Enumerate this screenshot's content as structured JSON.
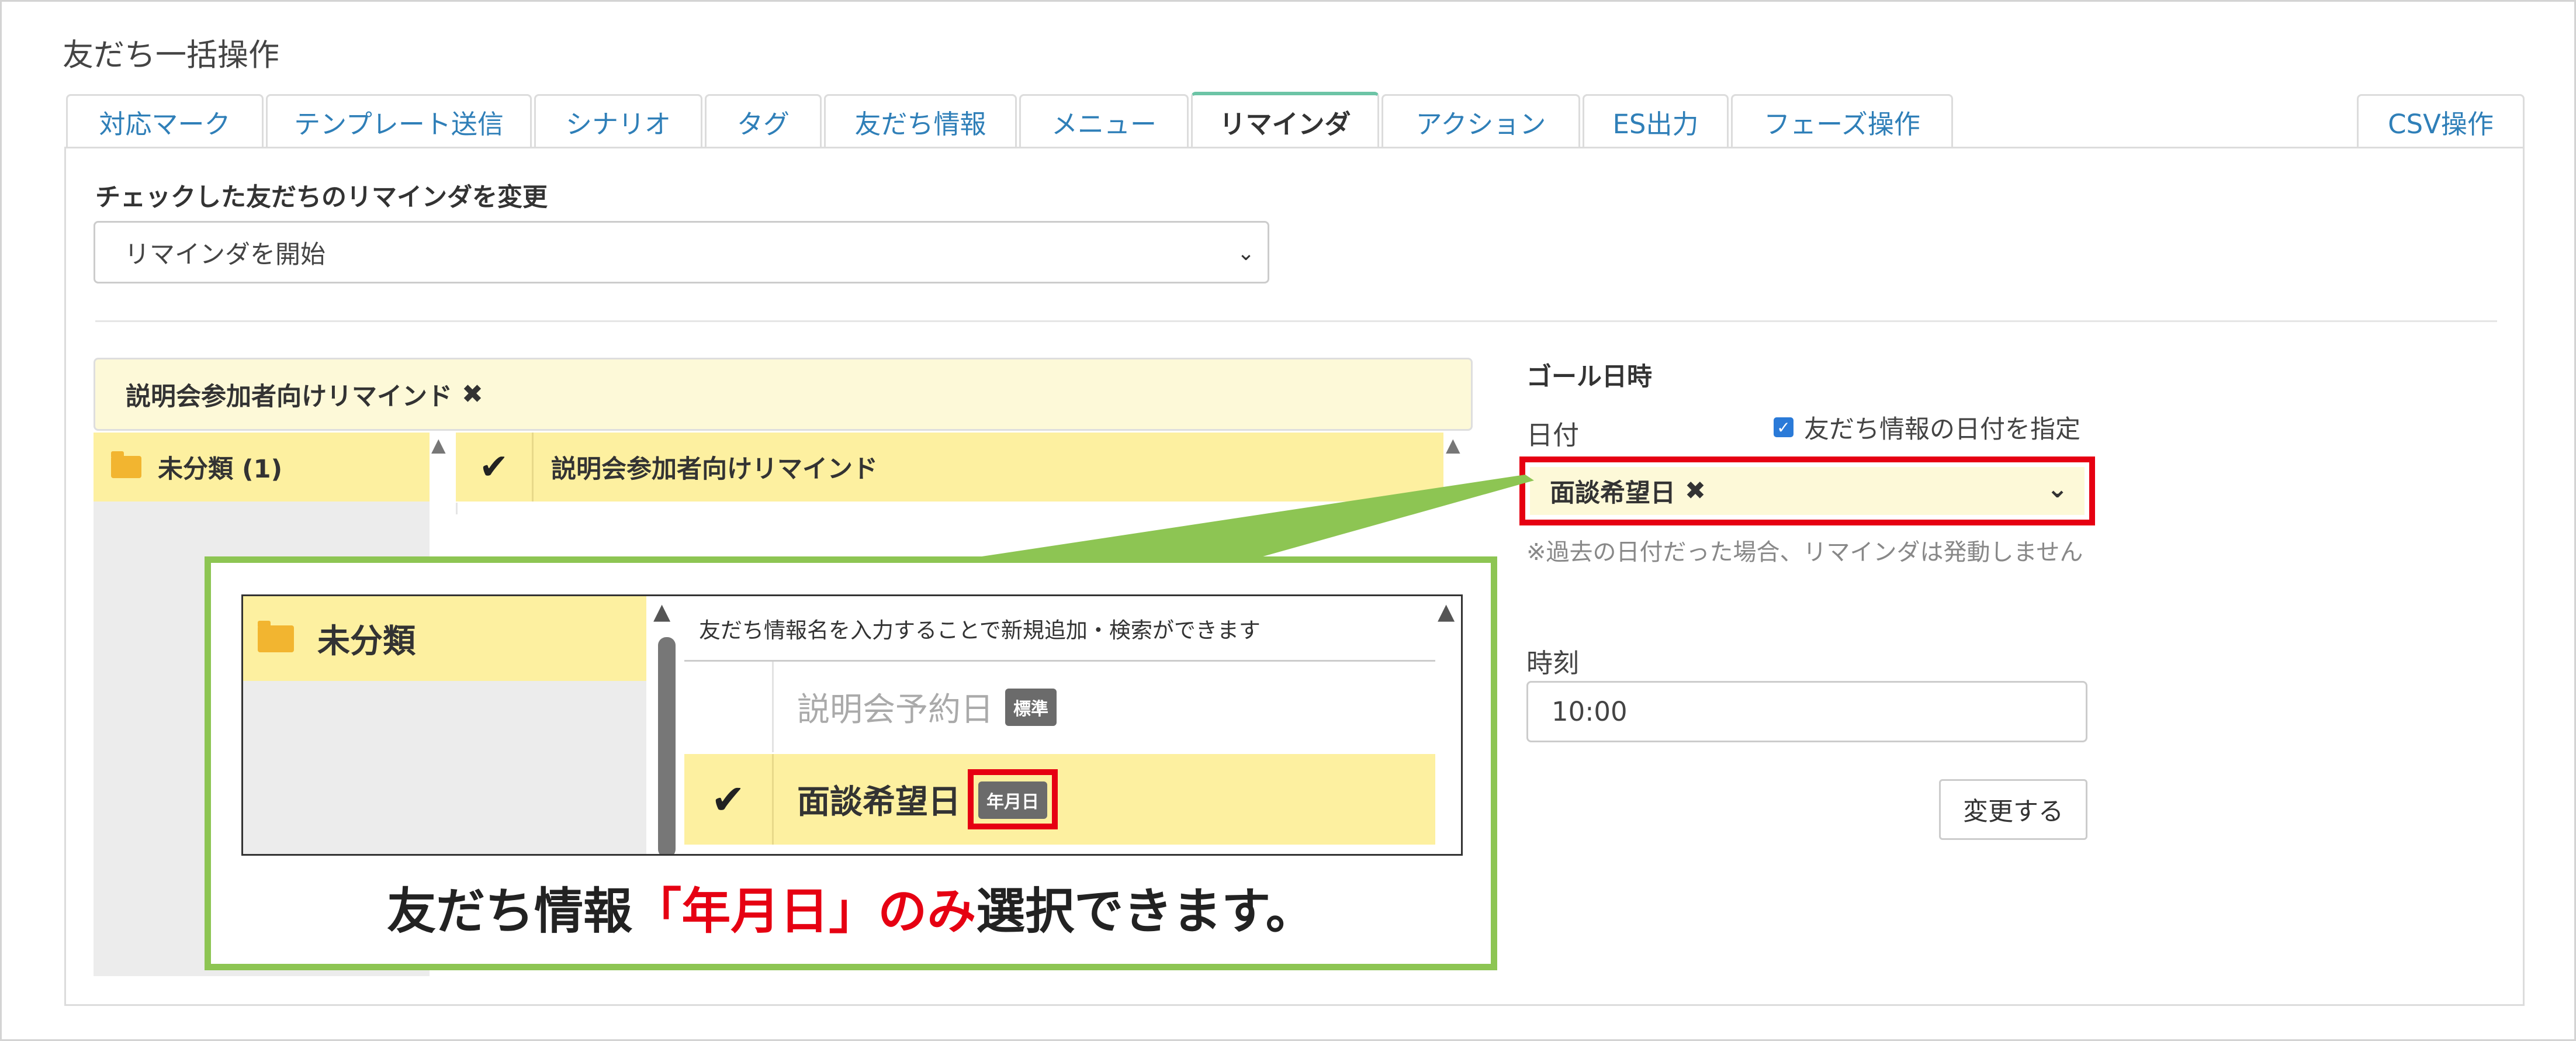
{
  "page": {
    "title": "友だち一括操作"
  },
  "tabs": [
    {
      "label": "対応マーク"
    },
    {
      "label": "テンプレート送信"
    },
    {
      "label": "シナリオ"
    },
    {
      "label": "タグ"
    },
    {
      "label": "友だち情報"
    },
    {
      "label": "メニュー"
    },
    {
      "label": "リマインダ"
    },
    {
      "label": "アクション"
    },
    {
      "label": "ES出力"
    },
    {
      "label": "フェーズ操作"
    },
    {
      "label": "CSV操作"
    }
  ],
  "active_tab": "リマインダ",
  "section": {
    "label": "チェックした友だちのリマインダを変更",
    "select_value": "リマインダを開始"
  },
  "reminder": {
    "selected": "説明会参加者向けリマインド",
    "folder": "未分類 (1)",
    "item": "説明会参加者向けリマインド"
  },
  "goal": {
    "title": "ゴール日時",
    "date_label": "日付",
    "checkbox_label": "友だち情報の日付を指定",
    "checkbox_checked": true,
    "selected_field": "面談希望日",
    "note": "※過去の日付だった場合、リマインダは発動しません",
    "time_label": "時刻",
    "time_value": "10:00",
    "submit": "変更する"
  },
  "callout": {
    "folder": "未分類",
    "search_placeholder": "友だち情報名を入力することで新規追加・検索ができます",
    "row1_name": "説明会予約日",
    "row1_badge": "標準",
    "row2_name": "面談希望日",
    "row2_badge": "年月日",
    "caption_pre": "友だち情報",
    "caption_red": "「年月日」のみ",
    "caption_post": "選択できます。"
  },
  "colors": {
    "accent_green": "#8dc553",
    "highlight_red": "#e60012",
    "selected_yellow": "#fdf0a0",
    "link_blue": "#2f7fb8"
  }
}
